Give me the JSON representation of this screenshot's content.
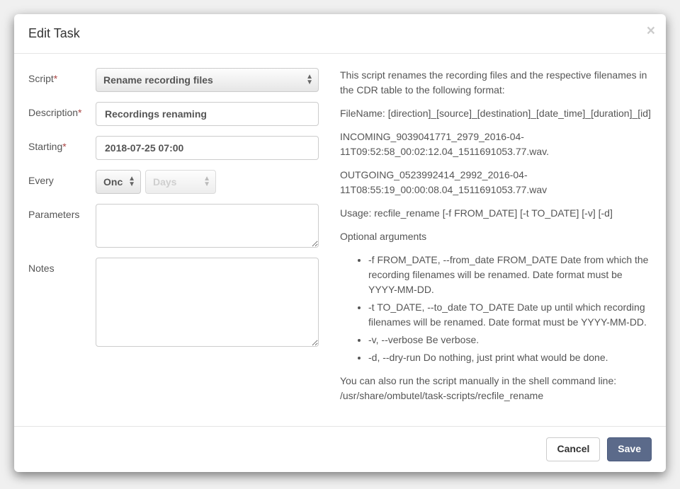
{
  "header": {
    "title": "Edit Task",
    "close": "×"
  },
  "form": {
    "labels": {
      "script": "Script",
      "description": "Description",
      "starting": "Starting",
      "every": "Every",
      "parameters": "Parameters",
      "notes": "Notes",
      "required_mark": "*"
    },
    "values": {
      "script": "Rename recording files",
      "description": "Recordings renaming",
      "starting": "2018-07-25 07:00",
      "every_count": "Once",
      "every_unit": "Days",
      "parameters": "",
      "notes": ""
    }
  },
  "doc": {
    "intro": "This script renames the recording files and the respective filenames in the CDR table to the following format:",
    "filename_label": "FileName:",
    "filename_format": "[direction]_[source]_[destination]_[date_time]_[duration]_[id]",
    "example1": "INCOMING_9039041771_2979_2016-04-11T09:52:58_00:02:12.04_1511691053.77.wav.",
    "example2": "OUTGOING_0523992414_2992_2016-04-11T08:55:19_00:00:08.04_1511691053.77.wav",
    "usage": "Usage: recfile_rename [-f FROM_DATE] [-t TO_DATE] [-v] [-d]",
    "optional_heading": "Optional arguments",
    "args": [
      "-f FROM_DATE, --from_date FROM_DATE Date from which the recording filenames will be renamed. Date format must be YYYY-MM-DD.",
      "-t TO_DATE, --to_date TO_DATE Date up until which recording filenames will be renamed. Date format must be YYYY-MM-DD.",
      "-v, --verbose Be verbose.",
      "-d, --dry-run Do nothing, just print what would be done."
    ],
    "manual": "You can also run the script manually in the shell command line: /usr/share/ombutel/task-scripts/recfile_rename"
  },
  "footer": {
    "cancel": "Cancel",
    "save": "Save"
  }
}
